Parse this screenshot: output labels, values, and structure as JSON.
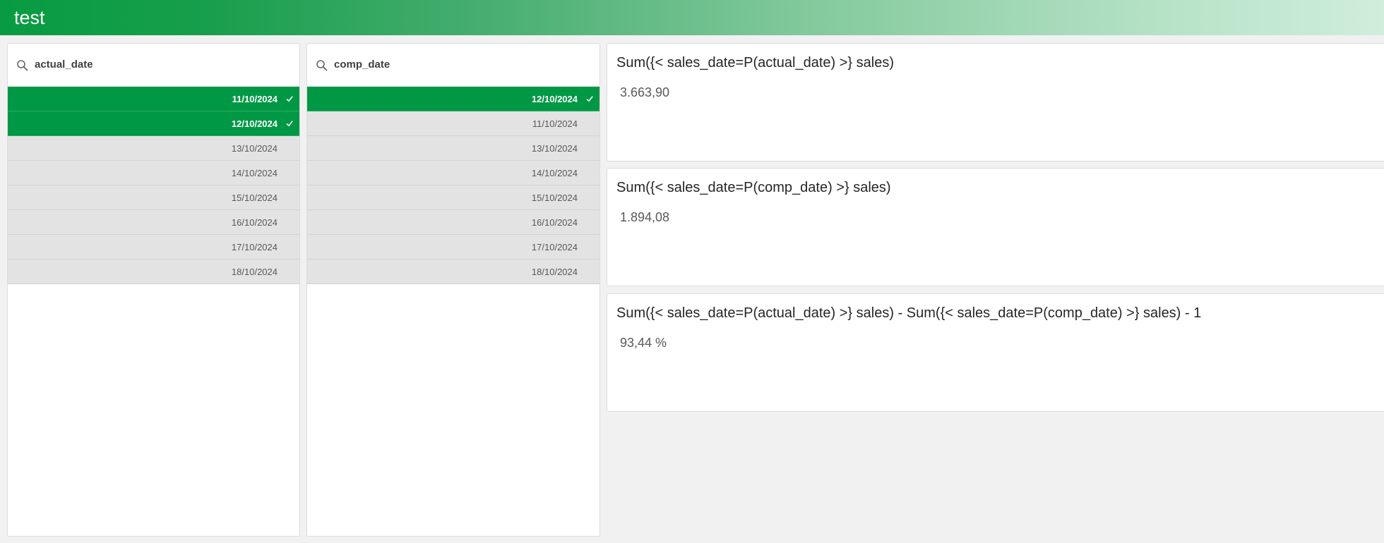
{
  "app": {
    "title": "test"
  },
  "listboxes": [
    {
      "field": "actual_date",
      "rows": [
        {
          "value": "11/10/2024",
          "selected": true
        },
        {
          "value": "12/10/2024",
          "selected": true
        },
        {
          "value": "13/10/2024",
          "selected": false
        },
        {
          "value": "14/10/2024",
          "selected": false
        },
        {
          "value": "15/10/2024",
          "selected": false
        },
        {
          "value": "16/10/2024",
          "selected": false
        },
        {
          "value": "17/10/2024",
          "selected": false
        },
        {
          "value": "18/10/2024",
          "selected": false
        }
      ]
    },
    {
      "field": "comp_date",
      "rows": [
        {
          "value": "12/10/2024",
          "selected": true
        },
        {
          "value": "11/10/2024",
          "selected": false
        },
        {
          "value": "13/10/2024",
          "selected": false
        },
        {
          "value": "14/10/2024",
          "selected": false
        },
        {
          "value": "15/10/2024",
          "selected": false
        },
        {
          "value": "16/10/2024",
          "selected": false
        },
        {
          "value": "17/10/2024",
          "selected": false
        },
        {
          "value": "18/10/2024",
          "selected": false
        }
      ]
    }
  ],
  "kpis": [
    {
      "title": "Sum({< sales_date=P(actual_date) >} sales)",
      "value": "3.663,90"
    },
    {
      "title": "Sum({< sales_date=P(comp_date) >} sales)",
      "value": "1.894,08"
    },
    {
      "title": "Sum({< sales_date=P(actual_date) >} sales) - Sum({< sales_date=P(comp_date) >} sales) - 1",
      "value": "93,44 %"
    }
  ],
  "icons": {
    "search": "search-icon",
    "selected": "check-icon"
  },
  "colors": {
    "selected": "#009845",
    "possible": "#e3e3e3",
    "header_start": "#079c42"
  }
}
